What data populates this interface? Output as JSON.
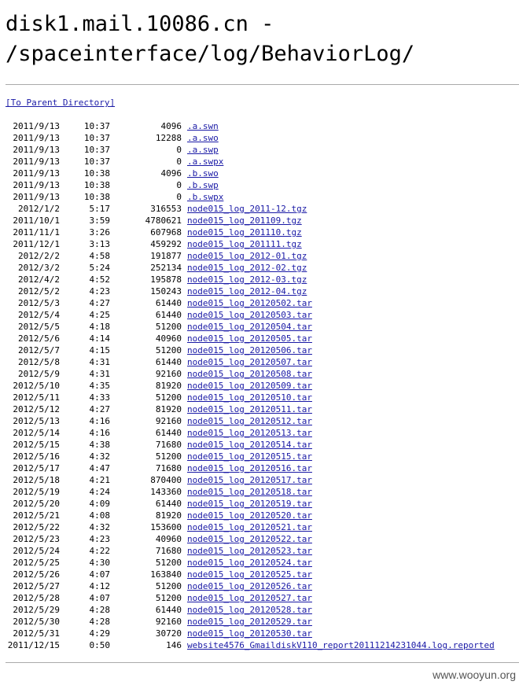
{
  "page": {
    "title_line1": "disk1.mail.10086.cn -",
    "title_line2": "/spaceinterface/log/BehaviorLog/",
    "parent_link": "[To Parent Directory]",
    "watermark": "www.wooyun.org"
  },
  "files": [
    {
      "date": "2011/9/13",
      "time": "10:37",
      "size": "4096",
      "name": ".a.swn"
    },
    {
      "date": "2011/9/13",
      "time": "10:37",
      "size": "12288",
      "name": ".a.swo"
    },
    {
      "date": "2011/9/13",
      "time": "10:37",
      "size": "0",
      "name": ".a.swp"
    },
    {
      "date": "2011/9/13",
      "time": "10:37",
      "size": "0",
      "name": ".a.swpx"
    },
    {
      "date": "2011/9/13",
      "time": "10:38",
      "size": "4096",
      "name": ".b.swo"
    },
    {
      "date": "2011/9/13",
      "time": "10:38",
      "size": "0",
      "name": ".b.swp"
    },
    {
      "date": "2011/9/13",
      "time": "10:38",
      "size": "0",
      "name": ".b.swpx"
    },
    {
      "date": "2012/1/2",
      "time": "5:17",
      "size": "316553",
      "name": "node015_log_2011-12.tgz"
    },
    {
      "date": "2011/10/1",
      "time": "3:59",
      "size": "4780621",
      "name": "node015_log_201109.tgz"
    },
    {
      "date": "2011/11/1",
      "time": "3:26",
      "size": "607968",
      "name": "node015_log_201110.tgz"
    },
    {
      "date": "2011/12/1",
      "time": "3:13",
      "size": "459292",
      "name": "node015_log_201111.tgz"
    },
    {
      "date": "2012/2/2",
      "time": "4:58",
      "size": "191877",
      "name": "node015_log_2012-01.tgz"
    },
    {
      "date": "2012/3/2",
      "time": "5:24",
      "size": "252134",
      "name": "node015_log_2012-02.tgz"
    },
    {
      "date": "2012/4/2",
      "time": "4:52",
      "size": "195878",
      "name": "node015_log_2012-03.tgz"
    },
    {
      "date": "2012/5/2",
      "time": "4:23",
      "size": "150243",
      "name": "node015_log_2012-04.tgz"
    },
    {
      "date": "2012/5/3",
      "time": "4:27",
      "size": "61440",
      "name": "node015_log_20120502.tar"
    },
    {
      "date": "2012/5/4",
      "time": "4:25",
      "size": "61440",
      "name": "node015_log_20120503.tar"
    },
    {
      "date": "2012/5/5",
      "time": "4:18",
      "size": "51200",
      "name": "node015_log_20120504.tar"
    },
    {
      "date": "2012/5/6",
      "time": "4:14",
      "size": "40960",
      "name": "node015_log_20120505.tar"
    },
    {
      "date": "2012/5/7",
      "time": "4:15",
      "size": "51200",
      "name": "node015_log_20120506.tar"
    },
    {
      "date": "2012/5/8",
      "time": "4:31",
      "size": "61440",
      "name": "node015_log_20120507.tar"
    },
    {
      "date": "2012/5/9",
      "time": "4:31",
      "size": "92160",
      "name": "node015_log_20120508.tar"
    },
    {
      "date": "2012/5/10",
      "time": "4:35",
      "size": "81920",
      "name": "node015_log_20120509.tar"
    },
    {
      "date": "2012/5/11",
      "time": "4:33",
      "size": "51200",
      "name": "node015_log_20120510.tar"
    },
    {
      "date": "2012/5/12",
      "time": "4:27",
      "size": "81920",
      "name": "node015_log_20120511.tar"
    },
    {
      "date": "2012/5/13",
      "time": "4:16",
      "size": "92160",
      "name": "node015_log_20120512.tar"
    },
    {
      "date": "2012/5/14",
      "time": "4:16",
      "size": "61440",
      "name": "node015_log_20120513.tar"
    },
    {
      "date": "2012/5/15",
      "time": "4:38",
      "size": "71680",
      "name": "node015_log_20120514.tar"
    },
    {
      "date": "2012/5/16",
      "time": "4:32",
      "size": "51200",
      "name": "node015_log_20120515.tar"
    },
    {
      "date": "2012/5/17",
      "time": "4:47",
      "size": "71680",
      "name": "node015_log_20120516.tar"
    },
    {
      "date": "2012/5/18",
      "time": "4:21",
      "size": "870400",
      "name": "node015_log_20120517.tar"
    },
    {
      "date": "2012/5/19",
      "time": "4:24",
      "size": "143360",
      "name": "node015_log_20120518.tar"
    },
    {
      "date": "2012/5/20",
      "time": "4:09",
      "size": "61440",
      "name": "node015_log_20120519.tar"
    },
    {
      "date": "2012/5/21",
      "time": "4:08",
      "size": "81920",
      "name": "node015_log_20120520.tar"
    },
    {
      "date": "2012/5/22",
      "time": "4:32",
      "size": "153600",
      "name": "node015_log_20120521.tar"
    },
    {
      "date": "2012/5/23",
      "time": "4:23",
      "size": "40960",
      "name": "node015_log_20120522.tar"
    },
    {
      "date": "2012/5/24",
      "time": "4:22",
      "size": "71680",
      "name": "node015_log_20120523.tar"
    },
    {
      "date": "2012/5/25",
      "time": "4:30",
      "size": "51200",
      "name": "node015_log_20120524.tar"
    },
    {
      "date": "2012/5/26",
      "time": "4:07",
      "size": "163840",
      "name": "node015_log_20120525.tar"
    },
    {
      "date": "2012/5/27",
      "time": "4:12",
      "size": "51200",
      "name": "node015_log_20120526.tar"
    },
    {
      "date": "2012/5/28",
      "time": "4:07",
      "size": "51200",
      "name": "node015_log_20120527.tar"
    },
    {
      "date": "2012/5/29",
      "time": "4:28",
      "size": "61440",
      "name": "node015_log_20120528.tar"
    },
    {
      "date": "2012/5/30",
      "time": "4:28",
      "size": "92160",
      "name": "node015_log_20120529.tar"
    },
    {
      "date": "2012/5/31",
      "time": "4:29",
      "size": "30720",
      "name": "node015_log_20120530.tar"
    },
    {
      "date": "2011/12/15",
      "time": "0:50",
      "size": "146",
      "name": "website4576_GmaildiskV110_report20111214231044.log.reported"
    }
  ]
}
